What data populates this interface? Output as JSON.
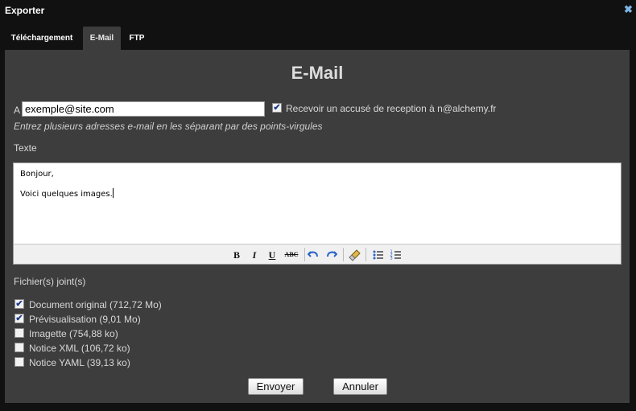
{
  "window": {
    "title": "Exporter",
    "close_icon": "close-icon"
  },
  "tabs": [
    {
      "label": "Téléchargement",
      "active": false
    },
    {
      "label": "E-Mail",
      "active": true
    },
    {
      "label": "FTP",
      "active": false
    }
  ],
  "email": {
    "heading": "E-Mail",
    "to_label": "A",
    "to_value": "exemple@site.com",
    "ack_checked": true,
    "ack_label": "Recevoir un accusé de reception à n@alchemy.fr",
    "hint": "Entrez plusieurs adresses e-mail en les séparant par des points-virgules",
    "text_label": "Texte",
    "body_lines": [
      "Bonjour,",
      "Voici quelques images."
    ],
    "toolbar": {
      "bold": "B",
      "italic": "I",
      "underline": "U",
      "strike": "ABC",
      "undo_icon": "undo-icon",
      "redo_icon": "redo-icon",
      "clean_icon": "eraser-brush-icon",
      "bullet_icon": "bullet-list-icon",
      "numbered_icon": "numbered-list-icon"
    },
    "attachments_label": "Fichier(s) joint(s)",
    "attachments": [
      {
        "label": "Document original (712,72 Mo)",
        "checked": true
      },
      {
        "label": "Prévisualisation (9,01 Mo)",
        "checked": true
      },
      {
        "label": "Imagette (754,88 ko)",
        "checked": false
      },
      {
        "label": "Notice XML (106,72 ko)",
        "checked": false
      },
      {
        "label": "Notice YAML (39,13 ko)",
        "checked": false
      }
    ],
    "send_label": "Envoyer",
    "cancel_label": "Annuler"
  },
  "colors": {
    "panel": "#3d3d3d",
    "background": "#111111",
    "close_icon": "#7fb6e6"
  }
}
